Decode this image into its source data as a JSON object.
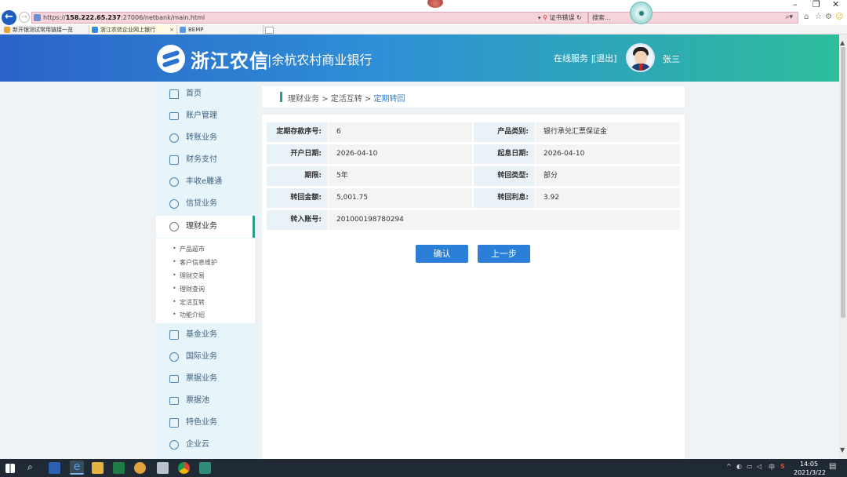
{
  "browser": {
    "url_prefix": "https://",
    "url_host": "158.222.65.237",
    "url_rest": ":27006/netbank/main.html",
    "cert_warning": "证书错误",
    "search_placeholder": "搜索...",
    "tabs": [
      {
        "label": "新开银测试常用链接一览"
      },
      {
        "label": "浙江农信企业网上银行"
      },
      {
        "label": "BEMP"
      }
    ],
    "tab_close": "×"
  },
  "header": {
    "logo_text": "浙江农信",
    "bank_name": "|余杭农村商业银行",
    "online_service": "在线服务 |",
    "logout": "[退出]",
    "user_name": "张三"
  },
  "sidebar": {
    "items": [
      {
        "label": "首页",
        "icon": "home-icon"
      },
      {
        "label": "账户管理",
        "icon": "card-icon"
      },
      {
        "label": "转账业务",
        "icon": "transfer-icon"
      },
      {
        "label": "财务支付",
        "icon": "payment-icon"
      },
      {
        "label": "丰收e雕通",
        "icon": "compass-icon"
      },
      {
        "label": "信贷业务",
        "icon": "loan-icon"
      },
      {
        "label": "理财业务",
        "icon": "wealth-icon"
      },
      {
        "label": "基金业务",
        "icon": "fund-icon"
      },
      {
        "label": "国际业务",
        "icon": "globe-icon"
      },
      {
        "label": "票据业务",
        "icon": "bill-icon"
      },
      {
        "label": "票据池",
        "icon": "bill-pool-icon"
      },
      {
        "label": "特色业务",
        "icon": "special-icon"
      },
      {
        "label": "企业云",
        "icon": "cloud-icon"
      }
    ],
    "sub_items": [
      {
        "label": "产品超市"
      },
      {
        "label": "客户信息维护"
      },
      {
        "label": "理财交易"
      },
      {
        "label": "理财查询"
      },
      {
        "label": "定活互转"
      },
      {
        "label": "功能介绍"
      }
    ]
  },
  "breadcrumb": {
    "level1": "理财业务",
    "sep1": " > ",
    "level2": "定活互转",
    "sep2": " > ",
    "current": "定期转回"
  },
  "form": {
    "rows": [
      {
        "label": "定期存款序号:",
        "value": "6",
        "label2": "产品类别:",
        "value2": "银行承兑汇票保证金"
      },
      {
        "label": "开户日期:",
        "value": "2026-04-10",
        "label2": "起息日期:",
        "value2": "2026-04-10"
      },
      {
        "label": "期限:",
        "value": "5年",
        "label2": "转回类型:",
        "value2": "部分"
      },
      {
        "label": "转回金额:",
        "value": "5,001.75",
        "label2": "转回利息:",
        "value2": "3.92"
      },
      {
        "label": "转入账号:",
        "value": "201000198780294"
      }
    ]
  },
  "buttons": {
    "confirm": "确认",
    "back": "上一步"
  },
  "taskbar": {
    "time": "14:05",
    "date": "2021/3/22",
    "ime": "中"
  }
}
